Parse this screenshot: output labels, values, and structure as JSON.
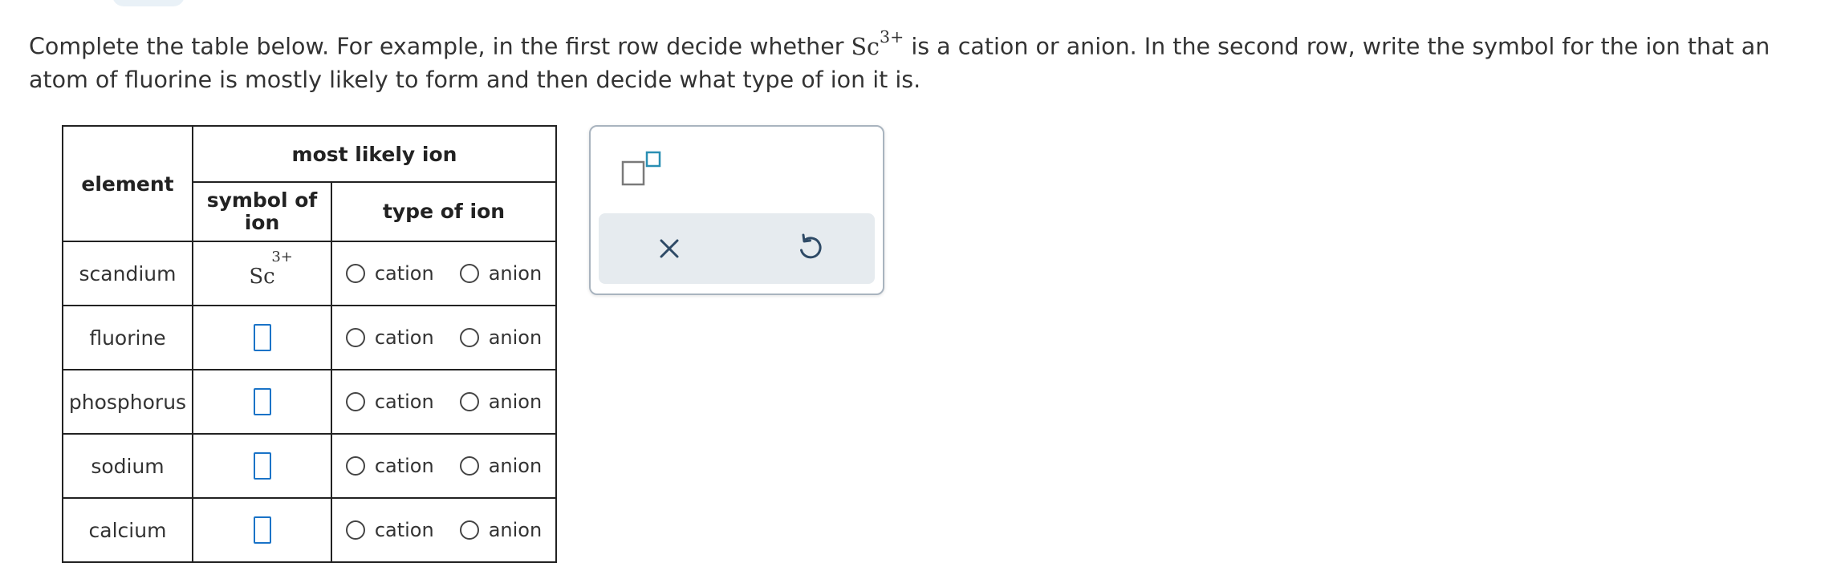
{
  "prompt": {
    "part1": "Complete the table below. For example, in the first row decide whether ",
    "example_ion_symbol": "Sc",
    "example_ion_charge": "3+",
    "part2": " is a cation or anion. In the second row, write the symbol for the ion that an atom of fluorine is mostly likely to form and then decide what type of ion it is."
  },
  "table": {
    "header_element": "element",
    "header_most_likely_ion": "most likely ion",
    "header_symbol_line1": "symbol of",
    "header_symbol_line2": "ion",
    "header_type": "type of ion",
    "rows": [
      {
        "element": "scandium",
        "symbol": "Sc",
        "charge": "3+",
        "option_cation": "cation",
        "option_anion": "anion"
      },
      {
        "element": "fluorine",
        "option_cation": "cation",
        "option_anion": "anion"
      },
      {
        "element": "phosphorus",
        "option_cation": "cation",
        "option_anion": "anion"
      },
      {
        "element": "sodium",
        "option_cation": "cation",
        "option_anion": "anion"
      },
      {
        "element": "calcium",
        "option_cation": "cation",
        "option_anion": "anion"
      }
    ]
  },
  "tools": {
    "superscript_icon": "superscript-box-icon",
    "clear_icon": "x-icon",
    "undo_icon": "undo-icon"
  },
  "colors": {
    "input_border": "#1a73c7",
    "tool_accent": "#2a8fb3",
    "panel_action_bg": "#e6ebef"
  }
}
